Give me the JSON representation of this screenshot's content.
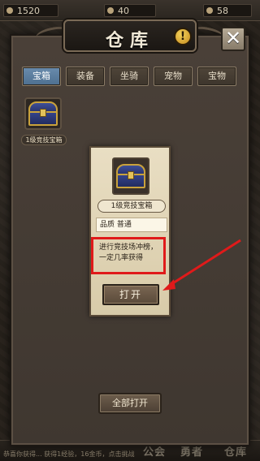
{
  "topbar": {
    "resources": [
      "1520",
      "40",
      "58"
    ]
  },
  "window": {
    "title": "仓库",
    "info_icon": "exclamation-icon",
    "close_icon": "close-icon",
    "close_glyph": "✕",
    "info_glyph": "!"
  },
  "tabs": [
    {
      "label": "宝箱",
      "active": true
    },
    {
      "label": "装备",
      "active": false
    },
    {
      "label": "坐骑",
      "active": false
    },
    {
      "label": "宠物",
      "active": false
    },
    {
      "label": "宝物",
      "active": false
    }
  ],
  "items": [
    {
      "label": "1级竞技宝箱",
      "icon": "treasure-chest-icon"
    }
  ],
  "detail": {
    "name": "1级竞技宝箱",
    "quality_label": "品质",
    "quality_value": "普通",
    "description": "进行竞技场冲榜，一定几率获得",
    "open_label": "打开"
  },
  "open_all_label": "全部打开",
  "bottom": {
    "log_text": "恭喜你获得... 获得1经验，16金币，点击挑战",
    "nav": [
      "公会",
      "勇者",
      "仓库"
    ]
  },
  "colors": {
    "tab_active": "#5a7c9e",
    "highlight": "#e01a1a",
    "parchment": "#e9dec3"
  }
}
